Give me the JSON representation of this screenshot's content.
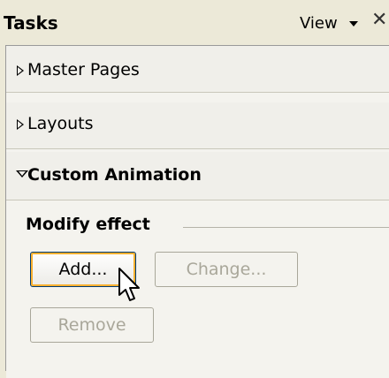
{
  "header": {
    "title": "Tasks",
    "view_label": "View"
  },
  "sections": [
    {
      "label": "Master Pages",
      "expanded": false
    },
    {
      "label": "Layouts",
      "expanded": false
    },
    {
      "label": "Custom Animation",
      "expanded": true
    }
  ],
  "modify_effect": {
    "title": "Modify effect",
    "add_button": "Add...",
    "change_button": "Change...",
    "remove_button": "Remove"
  },
  "icons": {
    "view_dropdown": "chevron-down-icon",
    "close": "close-icon",
    "collapsed": "triangle-right-icon",
    "expanded": "triangle-down-icon",
    "cursor": "mouse-pointer-icon"
  },
  "colors": {
    "background": "#ece9d8",
    "focus_border": "#f8b030",
    "disabled_text": "#a9a79a"
  }
}
